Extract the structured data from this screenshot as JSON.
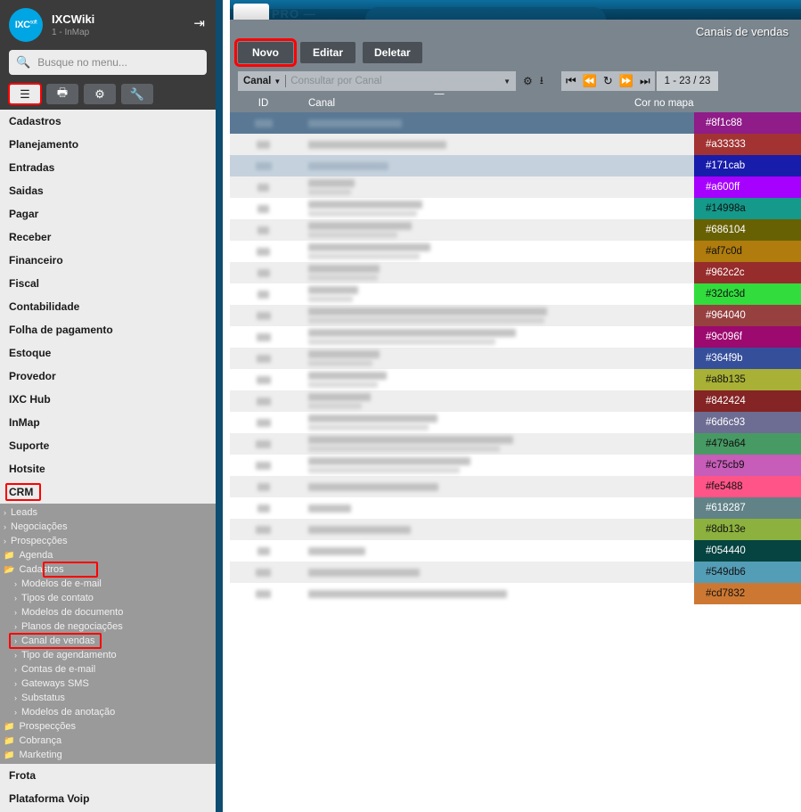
{
  "background": {
    "pro_label": "PRO —"
  },
  "sidebar": {
    "app_title": "IXCWiki",
    "app_subtitle": "1 - InMap",
    "logo_text": "IXC",
    "logo_sup": "soft",
    "logout_icon": "logout-icon",
    "search": {
      "placeholder": "Busque no menu...",
      "value": "",
      "icon": "search-icon"
    },
    "tabs": [
      {
        "name": "menu-tab",
        "icon": "list-icon",
        "active": true
      },
      {
        "name": "print-tab",
        "icon": "printer-icon",
        "active": false
      },
      {
        "name": "settings-tab",
        "icon": "gears-icon",
        "active": false
      },
      {
        "name": "tools-tab",
        "icon": "wrench-icon",
        "active": false
      }
    ],
    "items": [
      {
        "label": "Cadastros"
      },
      {
        "label": "Planejamento"
      },
      {
        "label": "Entradas"
      },
      {
        "label": "Saidas"
      },
      {
        "label": "Pagar"
      },
      {
        "label": "Receber"
      },
      {
        "label": "Financeiro"
      },
      {
        "label": "Fiscal"
      },
      {
        "label": "Contabilidade"
      },
      {
        "label": "Folha de pagamento"
      },
      {
        "label": "Estoque"
      },
      {
        "label": "Provedor"
      },
      {
        "label": "IXC Hub"
      },
      {
        "label": "InMap"
      },
      {
        "label": "Suporte"
      },
      {
        "label": "Hotsite"
      },
      {
        "label": "CRM"
      }
    ],
    "submenu": [
      {
        "label": "Leads",
        "icon": "chevron-right-icon",
        "level": 1
      },
      {
        "label": "Negociações",
        "icon": "chevron-right-icon",
        "level": 1
      },
      {
        "label": "Prospecções",
        "icon": "chevron-right-icon",
        "level": 1
      },
      {
        "label": "Agenda",
        "icon": "folder-icon",
        "level": 1
      },
      {
        "label": "Cadastros",
        "icon": "folder-open-icon",
        "level": 1
      },
      {
        "label": "Modelos de e-mail",
        "icon": "chevron-right-icon",
        "level": 2
      },
      {
        "label": "Tipos de contato",
        "icon": "chevron-right-icon",
        "level": 2
      },
      {
        "label": "Modelos de documento",
        "icon": "chevron-right-icon",
        "level": 2
      },
      {
        "label": "Planos de negociações",
        "icon": "chevron-right-icon",
        "level": 2
      },
      {
        "label": "Canal de vendas",
        "icon": "chevron-right-icon",
        "level": 2
      },
      {
        "label": "Tipo de agendamento",
        "icon": "chevron-right-icon",
        "level": 2
      },
      {
        "label": "Contas de e-mail",
        "icon": "chevron-right-icon",
        "level": 2
      },
      {
        "label": "Gateways SMS",
        "icon": "chevron-right-icon",
        "level": 2
      },
      {
        "label": "Substatus",
        "icon": "chevron-right-icon",
        "level": 2
      },
      {
        "label": "Modelos de anotação",
        "icon": "chevron-right-icon",
        "level": 2
      },
      {
        "label": "Prospecções",
        "icon": "folder-icon",
        "level": 1
      },
      {
        "label": "Cobrança",
        "icon": "folder-icon",
        "level": 1
      },
      {
        "label": "Marketing",
        "icon": "folder-icon",
        "level": 1
      }
    ],
    "items_tail": [
      {
        "label": "Frota"
      },
      {
        "label": "Plataforma Voip"
      }
    ]
  },
  "panel": {
    "title": "Canais de vendas",
    "buttons": [
      {
        "label": "Novo",
        "highlighted": true
      },
      {
        "label": "Editar",
        "highlighted": false
      },
      {
        "label": "Deletar",
        "highlighted": false
      }
    ],
    "filter": {
      "field_label": "Canal",
      "placeholder": "Consultar por Canal",
      "value": "",
      "dropdown_icon": "chevron-down-icon",
      "settings_icon": "gears-icon",
      "export_icon": "download-icon"
    },
    "pager": {
      "first_icon": "first-page-icon",
      "prev_icon": "prev-page-icon",
      "refresh_icon": "refresh-icon",
      "next_icon": "next-page-icon",
      "last_icon": "last-page-icon",
      "count_label": "1 - 23 / 23"
    }
  },
  "table": {
    "columns": [
      "ID",
      "Canal",
      "Cor no mapa"
    ],
    "rows": [
      {
        "color": "#8f1c88",
        "text_color": "#ffffff",
        "state": "selected",
        "id_w": 20,
        "name_w": 105,
        "sub_w": 0
      },
      {
        "color": "#a33333",
        "text_color": "#ffffff",
        "state": "odd",
        "id_w": 15,
        "name_w": 155,
        "sub_w": 0
      },
      {
        "color": "#171cab",
        "text_color": "#ffffff",
        "state": "hover",
        "id_w": 18,
        "name_w": 90,
        "sub_w": 0
      },
      {
        "color": "#a600ff",
        "text_color": "#ffffff",
        "state": "odd",
        "id_w": 13,
        "name_w": 52,
        "sub_w": 48
      },
      {
        "color": "#14998a",
        "text_color": "#111111",
        "state": "even",
        "id_w": 13,
        "name_w": 128,
        "sub_w": 122
      },
      {
        "color": "#686104",
        "text_color": "#ffffff",
        "state": "odd",
        "id_w": 13,
        "name_w": 116,
        "sub_w": 100
      },
      {
        "color": "#af7c0d",
        "text_color": "#111111",
        "state": "even",
        "id_w": 15,
        "name_w": 137,
        "sub_w": 125
      },
      {
        "color": "#962c2c",
        "text_color": "#ffffff",
        "state": "odd",
        "id_w": 14,
        "name_w": 80,
        "sub_w": 78
      },
      {
        "color": "#32dc3d",
        "text_color": "#111111",
        "state": "even",
        "id_w": 13,
        "name_w": 56,
        "sub_w": 50
      },
      {
        "color": "#964040",
        "text_color": "#ffffff",
        "state": "odd",
        "id_w": 16,
        "name_w": 268,
        "sub_w": 265
      },
      {
        "color": "#9c096f",
        "text_color": "#ffffff",
        "state": "even",
        "id_w": 16,
        "name_w": 233,
        "sub_w": 210
      },
      {
        "color": "#364f9b",
        "text_color": "#ffffff",
        "state": "odd",
        "id_w": 16,
        "name_w": 80,
        "sub_w": 72
      },
      {
        "color": "#a8b135",
        "text_color": "#111111",
        "state": "even",
        "id_w": 16,
        "name_w": 88,
        "sub_w": 78
      },
      {
        "color": "#842424",
        "text_color": "#ffffff",
        "state": "odd",
        "id_w": 16,
        "name_w": 70,
        "sub_w": 60
      },
      {
        "color": "#6d6c93",
        "text_color": "#ffffff",
        "state": "even",
        "id_w": 16,
        "name_w": 145,
        "sub_w": 135
      },
      {
        "color": "#479a64",
        "text_color": "#111111",
        "state": "odd",
        "id_w": 17,
        "name_w": 230,
        "sub_w": 215
      },
      {
        "color": "#c75cb9",
        "text_color": "#111111",
        "state": "even",
        "id_w": 17,
        "name_w": 182,
        "sub_w": 170
      },
      {
        "color": "#fe5488",
        "text_color": "#111111",
        "state": "odd",
        "id_w": 14,
        "name_w": 146,
        "sub_w": 0
      },
      {
        "color": "#618287",
        "text_color": "#ffffff",
        "state": "even",
        "id_w": 14,
        "name_w": 48,
        "sub_w": 0
      },
      {
        "color": "#8db13e",
        "text_color": "#111111",
        "state": "odd",
        "id_w": 17,
        "name_w": 115,
        "sub_w": 0
      },
      {
        "color": "#054440",
        "text_color": "#ffffff",
        "state": "even",
        "id_w": 14,
        "name_w": 64,
        "sub_w": 0
      },
      {
        "color": "#549db6",
        "text_color": "#111111",
        "state": "odd",
        "id_w": 17,
        "name_w": 125,
        "sub_w": 0
      },
      {
        "color": "#cd7832",
        "text_color": "#111111",
        "state": "even",
        "id_w": 17,
        "name_w": 223,
        "sub_w": 0
      }
    ]
  }
}
